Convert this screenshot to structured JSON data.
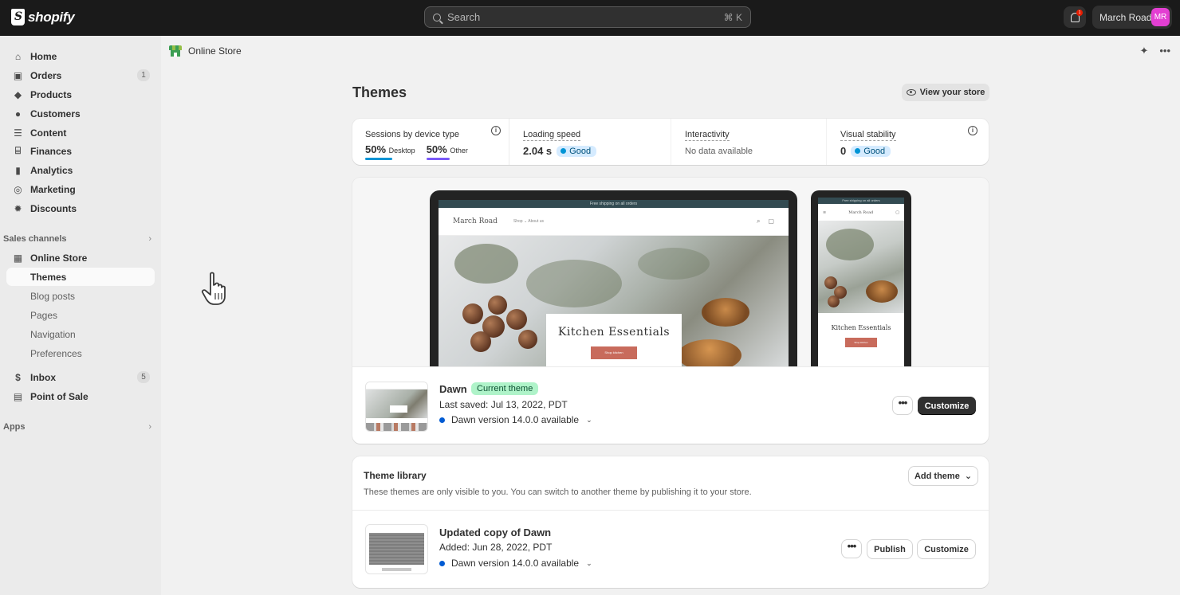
{
  "app": {
    "brand": "shopify",
    "search_placeholder": "Search",
    "search_shortcut": "⌘ K",
    "notification_count": "1",
    "store_name": "March Road",
    "avatar_initials": "MR",
    "accent_avatar": "#e33fd2"
  },
  "sidebar": {
    "items": [
      {
        "label": "Home",
        "icon": "home-icon"
      },
      {
        "label": "Orders",
        "icon": "orders-icon",
        "count": "1"
      },
      {
        "label": "Products",
        "icon": "tag-icon"
      },
      {
        "label": "Customers",
        "icon": "person-icon"
      },
      {
        "label": "Content",
        "icon": "content-icon"
      },
      {
        "label": "Finances",
        "icon": "bank-icon"
      },
      {
        "label": "Analytics",
        "icon": "bar-chart-icon"
      },
      {
        "label": "Marketing",
        "icon": "target-icon"
      },
      {
        "label": "Discounts",
        "icon": "discount-icon"
      }
    ],
    "sales_channels_label": "Sales channels",
    "online_store": "Online Store",
    "online_store_sub": [
      "Themes",
      "Blog posts",
      "Pages",
      "Navigation",
      "Preferences"
    ],
    "inbox": {
      "label": "Inbox",
      "count": "5"
    },
    "pos": "Point of Sale",
    "apps_label": "Apps"
  },
  "header": {
    "breadcrumb": "Online Store",
    "title": "Themes",
    "view_store_label": "View your store"
  },
  "metrics": {
    "sessions_label": "Sessions by device type",
    "desktop_pct": "50%",
    "desktop_label": "Desktop",
    "other_pct": "50%",
    "other_label": "Other",
    "loading_label": "Loading speed",
    "loading_value": "2.04 s",
    "loading_status": "Good",
    "interactivity_label": "Interactivity",
    "interactivity_value": "No data available",
    "stability_label": "Visual stability",
    "stability_value": "0",
    "stability_status": "Good",
    "desktop_color": "#0094d5",
    "other_color": "#7a5af8"
  },
  "preview": {
    "announcement": "Free shipping on all orders",
    "store_logo": "March Road",
    "nav_links": "Shop ⌄    About us",
    "hero_title": "Kitchen Essentials",
    "hero_button": "Shop kitchen"
  },
  "current_theme": {
    "name": "Dawn",
    "badge": "Current theme",
    "saved": "Last saved: Jul 13, 2022, PDT",
    "version": "Dawn version 14.0.0 available",
    "more_label": "•••",
    "customize_label": "Customize"
  },
  "library": {
    "title": "Theme library",
    "description": "These themes are only visible to you. You can switch to another theme by publishing it to your store.",
    "add_theme_label": "Add theme",
    "themes": [
      {
        "name": "Updated copy of Dawn",
        "added": "Added: Jun 28, 2022, PDT",
        "version": "Dawn version 14.0.0 available",
        "more_label": "•••",
        "publish_label": "Publish",
        "customize_label": "Customize"
      }
    ]
  }
}
